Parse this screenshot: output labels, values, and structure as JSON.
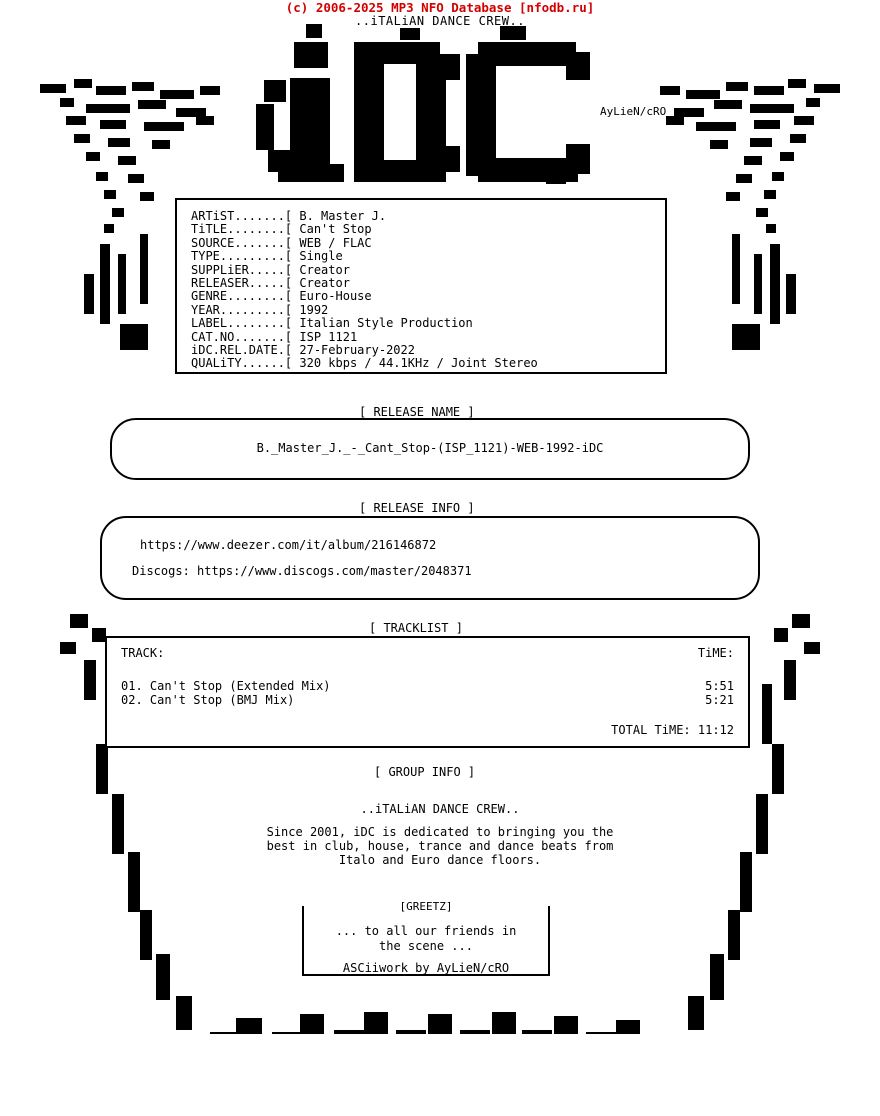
{
  "header": {
    "nfodb_line": "(c) 2006-2025 MP3 NFO Database [nfodb.ru]",
    "crew_tagline": "..iTALiAN DANCE CREW..",
    "artist_credit": "AyLieN/cRO"
  },
  "logo": {
    "ascii": [
      "              ▄▄▄▄▄      ▄▄▄▄▄▄▄▄▄▄     ▄▄▄▄▄▄▄▄",
      "            ▄█████▌   ▄███████████▄  ▄███████████▄",
      "            ▐████▌   ▐█████▀▀▀█████▌ ████▀▀▀▀▀████▌",
      "    ▄▄▄▄     ████▌   ▐████▌   ▐████▌▐████▌    ▀▀▀▀",
      "  ▄██████▄   ████▌   ▐████▌   ▐████▌▐████▌",
      " ▐███▀▀███▌  ████▌   ▐████▌   ▐████▌▐████▌",
      " ▐███  ███▌  ████▌   ▐████▌   ▐████▌▐████▌",
      "  ▀██████▀   ████▌   ▐█████▄▄▄█████▌ ████▄▄▄▄▄████▄",
      "    ▀▀▀▀     ▀▀▀▀     ▀██████████▀    ▀██████████▀",
      "                        ▀▀▀▀▀▀▀         ▀▀▀▀▀▀"
    ]
  },
  "release": {
    "fields": [
      {
        "label": "ARTiST.......[",
        "value": "B. Master J."
      },
      {
        "label": "TiTLE........[",
        "value": "Can't Stop"
      },
      {
        "label": "SOURCE.......[",
        "value": "WEB / FLAC"
      },
      {
        "label": "TYPE.........[",
        "value": "Single"
      },
      {
        "label": "SUPPLiER.....[",
        "value": "Creator"
      },
      {
        "label": "RELEASER.....[",
        "value": "Creator"
      },
      {
        "label": "GENRE........[",
        "value": "Euro-House"
      },
      {
        "label": "YEAR.........[",
        "value": "1992"
      },
      {
        "label": "LABEL........[",
        "value": "Italian Style Production"
      },
      {
        "label": "CAT.NO.......[",
        "value": "ISP 1121"
      },
      {
        "label": "iDC.REL.DATE.[",
        "value": "27-February-2022"
      },
      {
        "label": "QUALiTY......[",
        "value": "320 kbps / 44.1KHz / Joint Stereo"
      }
    ],
    "field_block": "ARTiST.......[ B. Master J.\nTiTLE........[ Can't Stop\nSOURCE.......[ WEB / FLAC\nTYPE.........[ Single\nSUPPLiER.....[ Creator\nRELEASER.....[ Creator\nGENRE........[ Euro-House\nYEAR.........[ 1992\nLABEL........[ Italian Style Production\nCAT.NO.......[ ISP 1121\niDC.REL.DATE.[ 27-February-2022\nQUALiTY......[ 320 kbps / 44.1KHz / Joint Stereo"
  },
  "sections": {
    "release_name_caption": "[ RELEASE NAME ]",
    "release_info_caption": "[ RELEASE INFO ]",
    "tracklist_caption": "[ TRACKLIST ]",
    "group_info_caption": "[ GROUP INFO ]"
  },
  "release_name": {
    "value": "B._Master_J._-_Cant_Stop-(ISP_1121)-WEB-1992-iDC"
  },
  "release_info": {
    "line1": "https://www.deezer.com/it/album/216146872",
    "line2": "Discogs: https://www.discogs.com/master/2048371"
  },
  "tracklist": {
    "col_track": "TRACK:",
    "col_time": "TiME:",
    "tracks": [
      {
        "title": "01. Can't Stop (Extended Mix)",
        "time": "5:51"
      },
      {
        "title": "02. Can't Stop (BMJ Mix)",
        "time": "5:21"
      }
    ],
    "total_label": "TOTAL TiME: 11:12"
  },
  "group_info": {
    "title": "..iTALiAN DANCE CREW..",
    "body": "Since 2001, iDC is dedicated to bringing you the\nbest in club, house, trance and dance beats from\nItalo and Euro dance floors."
  },
  "greetz": {
    "label": "[GREETZ]",
    "line1": "... to all our friends in",
    "line2": "the scene ...",
    "line3": "ASCiiwork by AyLieN/cRO"
  },
  "decor": {
    "left_wing": "  ▄▄▄                                 \n ███▀▀▄▄                              \n▐██   ▀██▄        ▄▄                  \n ▀█▄    ▀██▄    ▄██▀                  \n   ▀█▄    ▀█▄  ▄█▀                    \n     ▀█▄    ▀███▀                     \n       ▀█▄   ▐█▌                      \n         ▀█▄ ▐█▌                      \n           ▀█▐█▌                      ",
    "bottom_bar": "▐█▌ ▐█▌ ▐█▌ ▐█▌ ▐█▌ ▐█▌ ▐█▌ ▐█▌ ▐█▌ ▐█▌"
  }
}
